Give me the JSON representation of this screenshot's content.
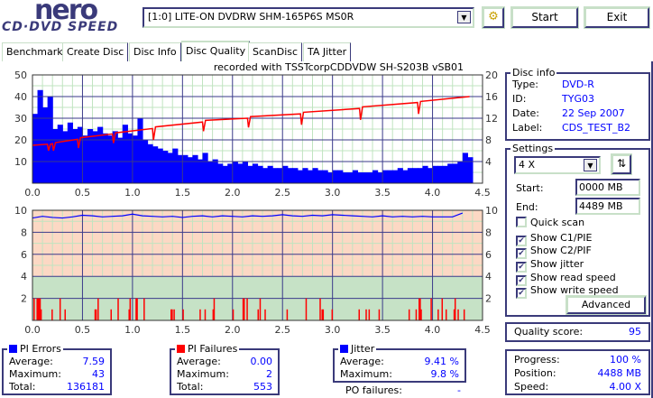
{
  "logo": {
    "line1": "nero",
    "line2": "CD·DVD SPEED"
  },
  "toolbar": {
    "drive": "[1:0]  LITE-ON DVDRW SHM-165P6S MS0R",
    "start_label": "Start",
    "exit_label": "Exit",
    "refresh_icon": "drive-refresh-icon"
  },
  "tabs": [
    {
      "label": "Benchmark"
    },
    {
      "label": "Create Disc"
    },
    {
      "label": "Disc Info"
    },
    {
      "label": "Disc Quality",
      "active": true
    },
    {
      "label": "ScanDisc"
    },
    {
      "label": "TA Jitter"
    }
  ],
  "caption": "recorded with TSSTcorpCDDVDW SH-S203B  vSB01",
  "colors": {
    "pie": "#0000ff",
    "pif": "#ff0000",
    "speed": "#ff0000",
    "jitter": "#0000ff",
    "grid_major": "#3a3a8a",
    "grid_minor": "#c0e4c0",
    "bad_zone": "#fcd8c4",
    "good_zone": "#c6e2c6"
  },
  "chart_data": [
    {
      "type": "bar",
      "name_hint": "pi-errors-and-read-speed",
      "xlim": [
        0,
        4.5
      ],
      "xticks": [
        "0.0",
        "0.5",
        "1.0",
        "1.5",
        "2.0",
        "2.5",
        "3.0",
        "3.5",
        "4.0",
        "4.5"
      ],
      "ylim_left": [
        0,
        50
      ],
      "yticks_left": [
        "10",
        "20",
        "30",
        "40",
        "50"
      ],
      "ylim_right": [
        0,
        20
      ],
      "yticks_right": [
        "4",
        "8",
        "12",
        "16",
        "20"
      ],
      "grid": true,
      "pi_errors": {
        "x_start": 0,
        "x_step": 0.05,
        "values": [
          32,
          43,
          35,
          40,
          25,
          27,
          24,
          28,
          25,
          26,
          22,
          25,
          24,
          26,
          23,
          22,
          24,
          21,
          27,
          23,
          22,
          30,
          20,
          18,
          17,
          16,
          15,
          14,
          16,
          13,
          13,
          12,
          13,
          11,
          14,
          10,
          11,
          9,
          8,
          9,
          10,
          9,
          10,
          8,
          9,
          8,
          7,
          8,
          7,
          7,
          8,
          7,
          7,
          6,
          7,
          6,
          7,
          6,
          6,
          5,
          6,
          6,
          5,
          5,
          6,
          5,
          5,
          5,
          6,
          5,
          6,
          6,
          6,
          7,
          6,
          7,
          7,
          7,
          8,
          7,
          8,
          8,
          8,
          9,
          9,
          10,
          14,
          12
        ]
      },
      "read_speed": [
        [
          0,
          7
        ],
        [
          0.15,
          7.2
        ],
        [
          0.16,
          6
        ],
        [
          0.18,
          7.2
        ],
        [
          0.2,
          7.3
        ],
        [
          0.21,
          6
        ],
        [
          0.23,
          7.5
        ],
        [
          0.45,
          8.1
        ],
        [
          0.46,
          6.5
        ],
        [
          0.48,
          8.4
        ],
        [
          0.8,
          9.1
        ],
        [
          0.81,
          7.4
        ],
        [
          0.83,
          9.3
        ],
        [
          1.2,
          10.1
        ],
        [
          1.21,
          8
        ],
        [
          1.23,
          10.4
        ],
        [
          1.7,
          11.3
        ],
        [
          1.71,
          9.6
        ],
        [
          1.73,
          11.6
        ],
        [
          2.15,
          12
        ],
        [
          2.16,
          10.3
        ],
        [
          2.18,
          12.3
        ],
        [
          2.68,
          12.8
        ],
        [
          2.69,
          10.8
        ],
        [
          2.71,
          13.1
        ],
        [
          3.27,
          13.8
        ],
        [
          3.28,
          11.7
        ],
        [
          3.3,
          14.1
        ],
        [
          3.85,
          14.9
        ],
        [
          3.86,
          12.8
        ],
        [
          3.88,
          15.1
        ],
        [
          4.37,
          16
        ]
      ]
    },
    {
      "type": "bar",
      "name_hint": "pi-failures-and-jitter",
      "xlim": [
        0,
        4.5
      ],
      "xticks": [
        "0.0",
        "0.5",
        "1.0",
        "1.5",
        "2.0",
        "2.5",
        "3.0",
        "3.5",
        "4.0",
        "4.5"
      ],
      "ylim": [
        0,
        10
      ],
      "yticks": [
        "2",
        "4",
        "6",
        "8",
        "10"
      ],
      "good_threshold": 4,
      "pi_failures": [
        [
          0.01,
          2
        ],
        [
          0.04,
          2
        ],
        [
          0.05,
          2
        ],
        [
          0.06,
          2
        ],
        [
          0.07,
          2
        ],
        [
          0.08,
          1
        ],
        [
          0.19,
          1
        ],
        [
          0.27,
          2
        ],
        [
          0.32,
          1
        ],
        [
          0.62,
          1
        ],
        [
          0.63,
          1
        ],
        [
          0.65,
          2
        ],
        [
          0.78,
          1
        ],
        [
          0.85,
          2
        ],
        [
          0.96,
          1
        ],
        [
          0.97,
          2
        ],
        [
          1.03,
          2
        ],
        [
          1.04,
          2
        ],
        [
          1.11,
          2
        ],
        [
          1.38,
          1
        ],
        [
          1.39,
          1
        ],
        [
          1.41,
          1
        ],
        [
          1.5,
          1
        ],
        [
          1.67,
          1
        ],
        [
          1.72,
          1
        ],
        [
          1.8,
          1
        ],
        [
          1.81,
          2
        ],
        [
          2.0,
          1
        ],
        [
          2.1,
          2
        ],
        [
          2.11,
          2
        ],
        [
          2.14,
          2
        ],
        [
          2.25,
          1
        ],
        [
          2.27,
          2
        ],
        [
          2.32,
          1
        ],
        [
          2.54,
          1
        ],
        [
          2.73,
          2
        ],
        [
          2.87,
          2
        ],
        [
          2.89,
          1
        ],
        [
          2.9,
          1
        ],
        [
          2.99,
          1
        ],
        [
          3.26,
          1
        ],
        [
          3.33,
          1
        ],
        [
          3.36,
          1
        ],
        [
          3.46,
          1
        ],
        [
          3.76,
          1
        ],
        [
          3.83,
          1
        ],
        [
          3.86,
          2
        ],
        [
          3.87,
          2
        ],
        [
          3.88,
          1
        ],
        [
          3.98,
          2
        ],
        [
          4.05,
          1
        ],
        [
          4.09,
          2
        ],
        [
          4.13,
          1
        ],
        [
          4.21,
          1
        ],
        [
          4.22,
          2
        ],
        [
          4.25,
          1
        ],
        [
          4.31,
          1
        ]
      ],
      "jitter": {
        "x_start": 0,
        "x_step": 0.1,
        "values": [
          9.3,
          9.45,
          9.35,
          9.3,
          9.4,
          9.55,
          9.5,
          9.4,
          9.45,
          9.5,
          9.65,
          9.5,
          9.45,
          9.4,
          9.45,
          9.35,
          9.45,
          9.5,
          9.4,
          9.5,
          9.45,
          9.4,
          9.5,
          9.45,
          9.5,
          9.6,
          9.5,
          9.45,
          9.55,
          9.5,
          9.6,
          9.55,
          9.5,
          9.45,
          9.4,
          9.5,
          9.4,
          9.45,
          9.4,
          9.45,
          9.4,
          9.4,
          9.4,
          9.75
        ]
      }
    }
  ],
  "disc_info": {
    "title": "Disc info",
    "rows": [
      {
        "label": "Type:",
        "value": "DVD-R"
      },
      {
        "label": "ID:",
        "value": "TYG03"
      },
      {
        "label": "Date:",
        "value": "22 Sep 2007"
      },
      {
        "label": "Label:",
        "value": "CDS_TEST_B2"
      }
    ]
  },
  "settings": {
    "title": "Settings",
    "speed": "4 X",
    "start_label": "Start:",
    "start_value": "0000 MB",
    "end_label": "End:",
    "end_value": "4489 MB",
    "checks": [
      {
        "label": "Quick scan",
        "checked": false
      },
      {
        "label": "Show C1/PIE",
        "checked": true
      },
      {
        "label": "Show C2/PIF",
        "checked": true
      },
      {
        "label": "Show jitter",
        "checked": true
      },
      {
        "label": "Show read speed",
        "checked": true
      },
      {
        "label": "Show write speed",
        "checked": true
      }
    ],
    "advanced_label": "Advanced"
  },
  "quality": {
    "label": "Quality score:",
    "value": "95"
  },
  "progress": {
    "rows": [
      {
        "label": "Progress:",
        "value": "100 %"
      },
      {
        "label": "Position:",
        "value": "4488 MB"
      },
      {
        "label": "Speed:",
        "value": "4.00 X"
      }
    ]
  },
  "pi_errors": {
    "title": "PI Errors",
    "rows": [
      {
        "label": "Average:",
        "value": "7.59"
      },
      {
        "label": "Maximum:",
        "value": "43"
      },
      {
        "label": "Total:",
        "value": "136181"
      }
    ]
  },
  "pi_failures": {
    "title": "PI Failures",
    "rows": [
      {
        "label": "Average:",
        "value": "0.00"
      },
      {
        "label": "Maximum:",
        "value": "2"
      },
      {
        "label": "Total:",
        "value": "553"
      }
    ]
  },
  "jitter": {
    "title": "Jitter",
    "rows": [
      {
        "label": "Average:",
        "value": "9.41 %"
      },
      {
        "label": "Maximum:",
        "value": "9.8 %"
      }
    ]
  },
  "po_failures": {
    "label": "PO failures:",
    "value": "-"
  }
}
